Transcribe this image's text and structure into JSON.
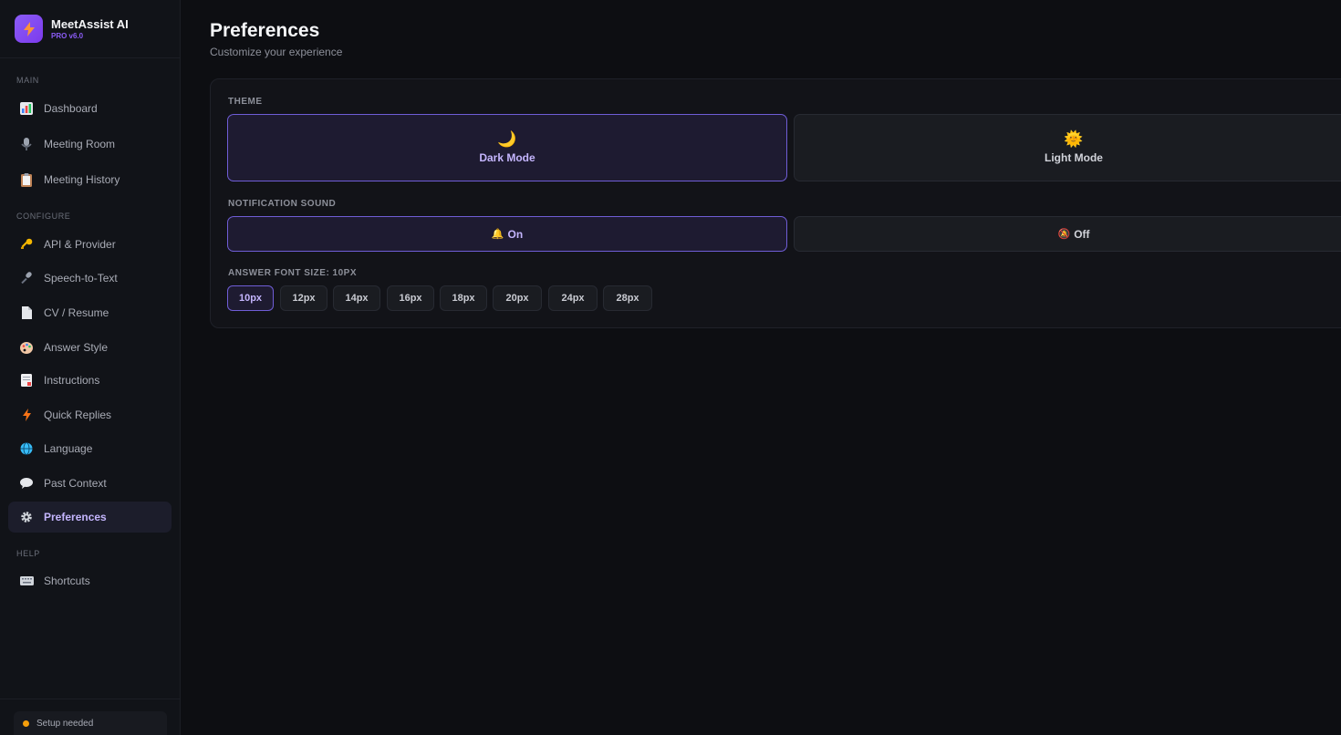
{
  "brand": {
    "name": "MeetAssist AI",
    "version": "PRO v6.0",
    "logo_icon": "bolt-icon",
    "accent": "#8b5cf6"
  },
  "sidebar": {
    "sections": {
      "main": "MAIN",
      "configure": "CONFIGURE",
      "help": "HELP"
    },
    "items": [
      {
        "label": "Dashboard",
        "icon": "bar-chart-icon"
      },
      {
        "label": "Meeting Room",
        "icon": "microphone-icon"
      },
      {
        "label": "Meeting History",
        "icon": "clipboard-icon"
      },
      {
        "label": "API & Provider",
        "icon": "key-icon"
      },
      {
        "label": "Speech-to-Text",
        "icon": "microphone-icon"
      },
      {
        "label": "CV / Resume",
        "icon": "document-icon"
      },
      {
        "label": "Answer Style",
        "icon": "palette-icon"
      },
      {
        "label": "Instructions",
        "icon": "notes-icon"
      },
      {
        "label": "Quick Replies",
        "icon": "bolt-icon"
      },
      {
        "label": "Language",
        "icon": "globe-icon"
      },
      {
        "label": "Past Context",
        "icon": "speech-bubble-icon"
      },
      {
        "label": "Preferences",
        "icon": "gear-icon",
        "active": true
      },
      {
        "label": "Shortcuts",
        "icon": "keyboard-icon"
      }
    ],
    "status": {
      "text": "Setup needed",
      "color": "#f59e0b"
    }
  },
  "page": {
    "title": "Preferences",
    "subtitle": "Customize your experience"
  },
  "preferences": {
    "theme": {
      "label": "THEME",
      "options": [
        {
          "label": "Dark Mode",
          "emoji": "🌙",
          "icon": "moon-icon",
          "selected": true
        },
        {
          "label": "Light Mode",
          "emoji": "🌞",
          "icon": "sun-icon",
          "selected": false
        }
      ]
    },
    "notification_sound": {
      "label": "NOTIFICATION SOUND",
      "options": [
        {
          "label": "On",
          "emoji": "🔔",
          "icon": "bell-icon",
          "selected": true
        },
        {
          "label": "Off",
          "emoji": "🔕",
          "icon": "bell-off-icon",
          "selected": false
        }
      ]
    },
    "font_size": {
      "label": "ANSWER FONT SIZE: 10PX",
      "options": [
        "10px",
        "12px",
        "14px",
        "16px",
        "18px",
        "20px",
        "24px",
        "28px"
      ],
      "selected": "10px"
    }
  }
}
